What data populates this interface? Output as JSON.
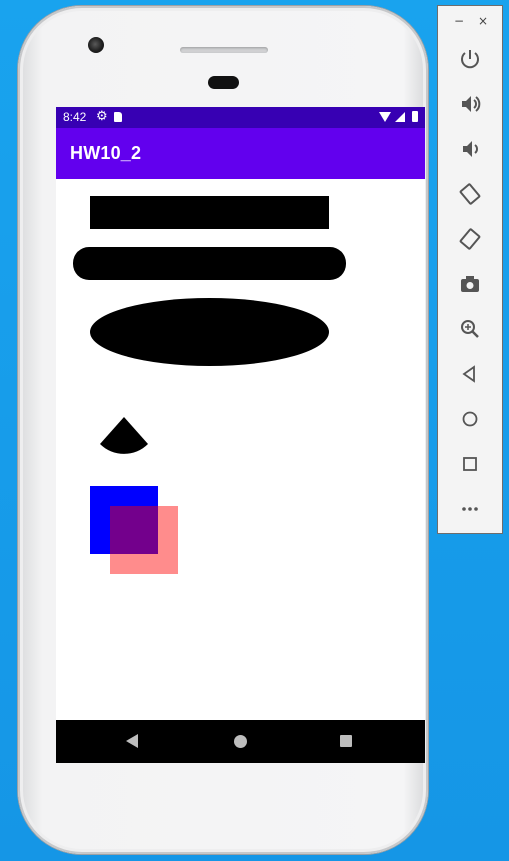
{
  "status_bar": {
    "time": "8:42"
  },
  "app_bar": {
    "title": "HW10_2"
  },
  "emulator_toolbar": {
    "window_controls": {
      "minimize": "−",
      "close": "×"
    },
    "buttons": [
      "power-icon",
      "volume-up-icon",
      "volume-down-icon",
      "rotate-left-icon",
      "rotate-right-icon",
      "camera-icon",
      "zoom-icon",
      "back-icon",
      "home-icon",
      "overview-icon",
      "more-icon"
    ]
  },
  "canvas_shapes": {
    "rectangle_color": "#000000",
    "rounded_rectangle_color": "#000000",
    "oval_color": "#000000",
    "arc_color": "#000000",
    "blue_square_color": "#0000ff",
    "pink_square_color": "#ff0000",
    "pink_square_opacity": 0.45
  },
  "colors": {
    "status_bar": "#3700b3",
    "app_bar": "#6200ee",
    "desktop": "#1a9fec"
  }
}
